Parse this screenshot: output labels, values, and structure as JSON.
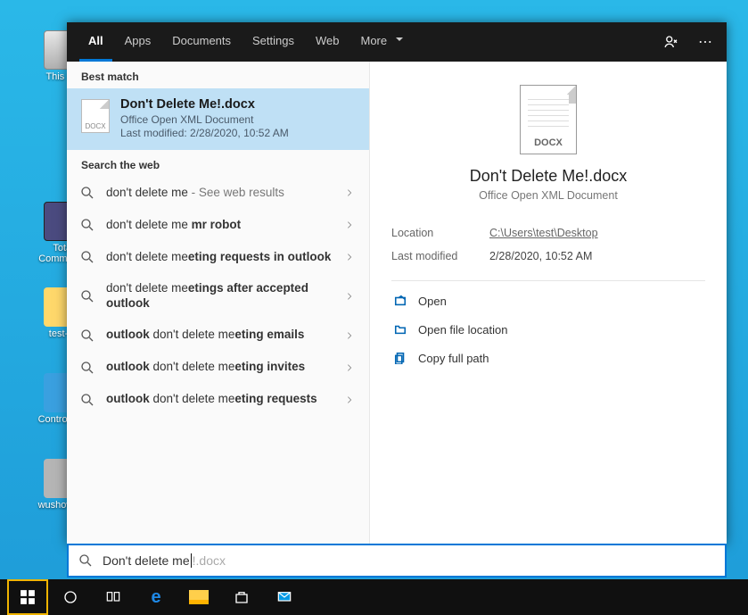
{
  "desktop": {
    "icons": [
      {
        "name": "this-pc",
        "label": "This PC"
      },
      {
        "name": "total-commander",
        "label": "Total Comman…"
      },
      {
        "name": "test-folder",
        "label": "test-…"
      },
      {
        "name": "control-panel",
        "label": "Control P…"
      },
      {
        "name": "wushowhide",
        "label": "wushowh…"
      }
    ]
  },
  "header": {
    "tabs": [
      "All",
      "Apps",
      "Documents",
      "Settings",
      "Web",
      "More"
    ]
  },
  "best_match": {
    "section": "Best match",
    "title": "Don't Delete Me!.docx",
    "subtitle": "Office Open XML Document",
    "modified": "Last modified: 2/28/2020, 10:52 AM",
    "docx_badge": "DOCX"
  },
  "web_section": "Search the web",
  "suggestions": [
    {
      "pre": "don't delete me",
      "rest": " - See web results",
      "light_rest": true
    },
    {
      "pre": "don't delete me ",
      "bold": "mr robot"
    },
    {
      "pre": "don't delete me",
      "bold": "eting requests in outlook"
    },
    {
      "pre": "don't delete me",
      "bold": "etings after accepted outlook"
    },
    {
      "bold_a": "outlook",
      "mid": " don't delete me",
      "bold_b": "eting emails"
    },
    {
      "bold_a": "outlook",
      "mid": " don't delete me",
      "bold_b": "eting invites"
    },
    {
      "bold_a": "outlook",
      "mid": " don't delete me",
      "bold_b": "eting requests"
    }
  ],
  "detail": {
    "docx_badge": "DOCX",
    "title": "Don't Delete Me!.docx",
    "subtitle": "Office Open XML Document",
    "location_label": "Location",
    "location_value": "C:\\Users\\test\\Desktop",
    "modified_label": "Last modified",
    "modified_value": "2/28/2020, 10:52 AM",
    "actions": {
      "open": "Open",
      "open_loc": "Open file location",
      "copy_path": "Copy full path"
    }
  },
  "search": {
    "typed": "Don't delete me",
    "completion": "!.docx"
  }
}
